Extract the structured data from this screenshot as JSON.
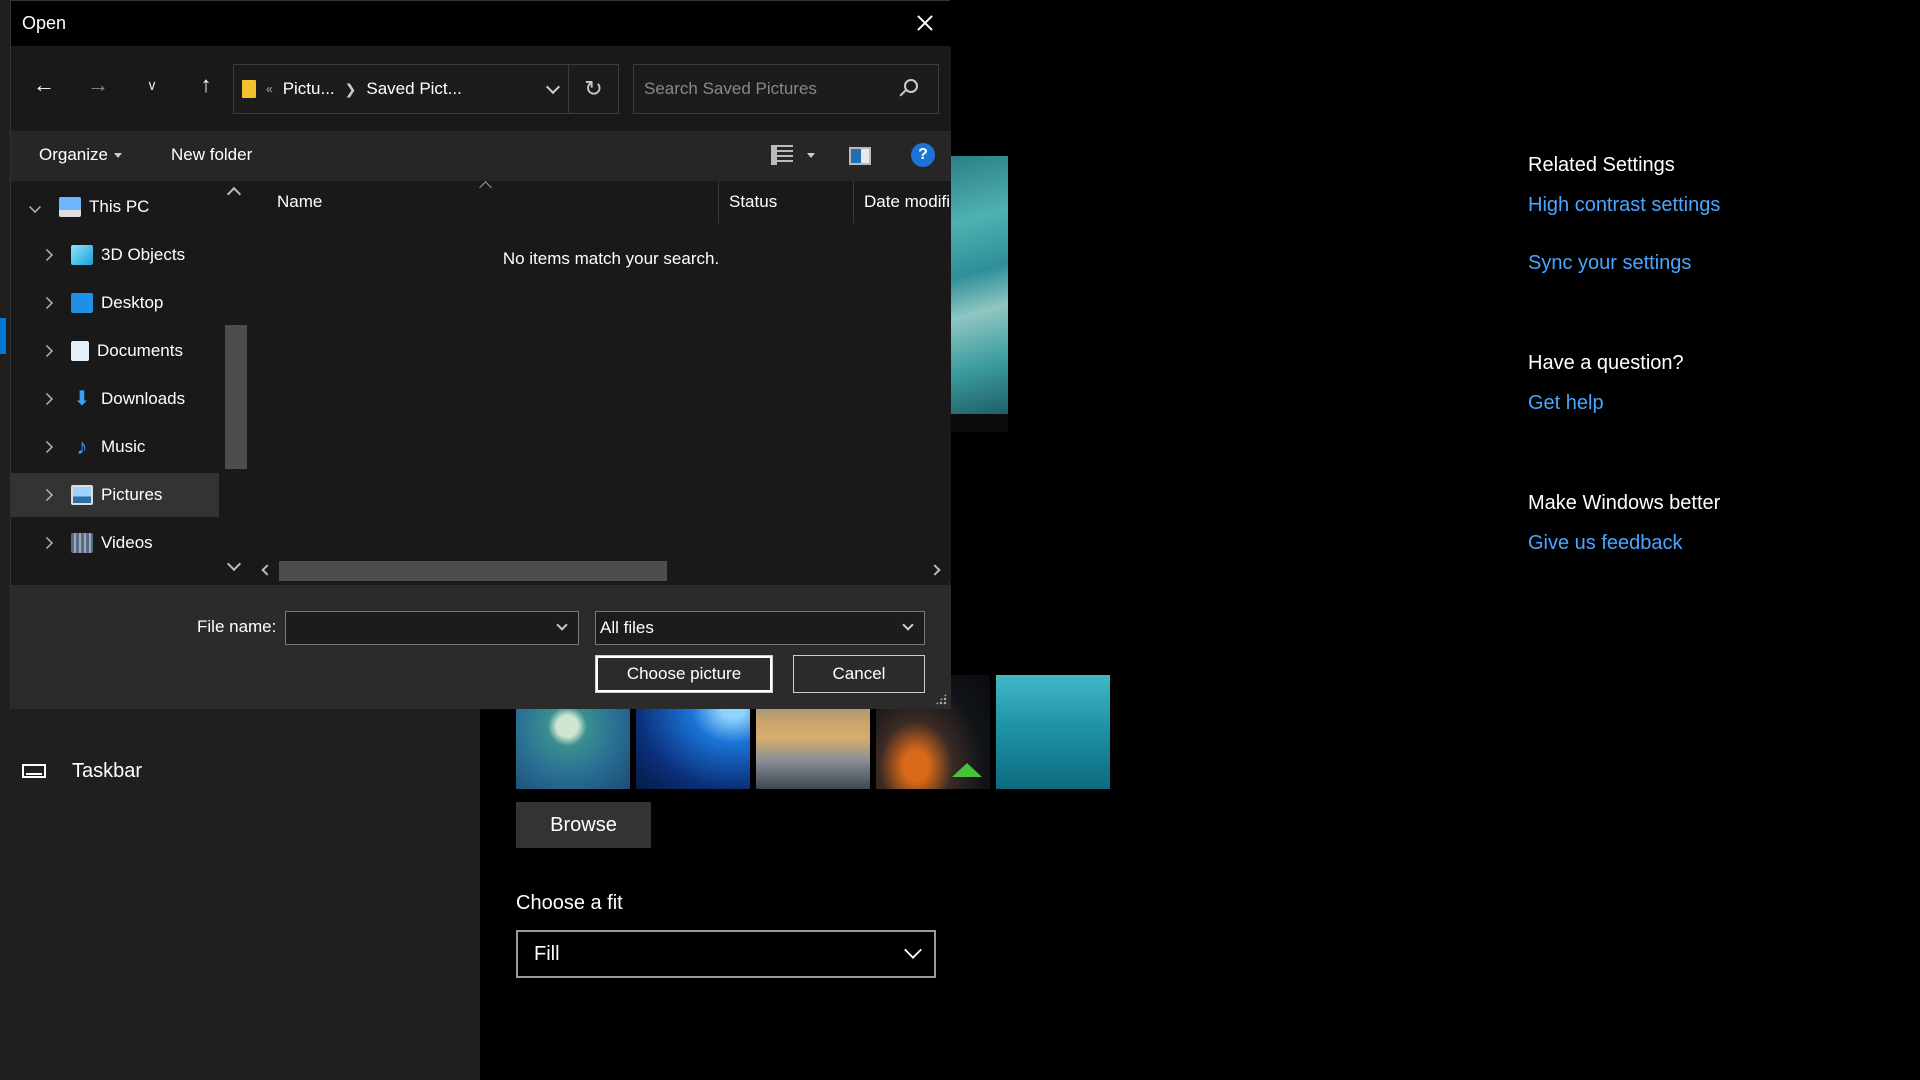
{
  "settings": {
    "left_nav": {
      "taskbar_label": "Taskbar"
    },
    "browse_label": "Browse",
    "fit": {
      "label": "Choose a fit",
      "value": "Fill"
    },
    "related": {
      "heading": "Related Settings",
      "high_contrast": "High contrast settings",
      "sync": "Sync your settings",
      "question_heading": "Have a question?",
      "get_help": "Get help",
      "better_heading": "Make Windows better",
      "feedback": "Give us feedback"
    },
    "link_color": "#4aa5ff"
  },
  "dialog": {
    "title": "Open",
    "address": {
      "overflow": "«",
      "crumbs": [
        "Pictu...",
        "Saved Pict..."
      ]
    },
    "search_placeholder": "Search Saved Pictures",
    "toolbar": {
      "organize": "Organize",
      "new_folder": "New folder",
      "help": "?"
    },
    "tree": [
      {
        "label": "This PC",
        "icon": "computer-icon",
        "expanded": true
      },
      {
        "label": "3D Objects",
        "icon": "cube-icon"
      },
      {
        "label": "Desktop",
        "icon": "desktop-icon"
      },
      {
        "label": "Documents",
        "icon": "document-icon"
      },
      {
        "label": "Downloads",
        "icon": "download-arrow-icon"
      },
      {
        "label": "Music",
        "icon": "music-note-icon"
      },
      {
        "label": "Pictures",
        "icon": "pictures-icon",
        "selected": true
      },
      {
        "label": "Videos",
        "icon": "film-icon"
      }
    ],
    "columns": {
      "name": "Name",
      "status": "Status",
      "date": "Date modifi"
    },
    "empty_message": "No items match your search.",
    "file_name_label": "File name:",
    "file_name_value": "",
    "filter_value": "All files",
    "choose_label": "Choose picture",
    "cancel_label": "Cancel"
  },
  "colors": {
    "accent": "#0078d7",
    "selection": "#333333",
    "help_blue": "#1e74d4"
  }
}
